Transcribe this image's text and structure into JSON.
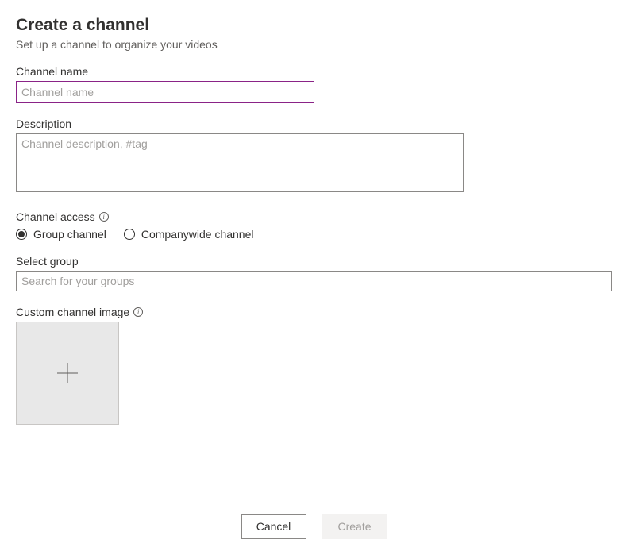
{
  "header": {
    "title": "Create a channel",
    "subtitle": "Set up a channel to organize your videos"
  },
  "channel_name": {
    "label": "Channel name",
    "placeholder": "Channel name",
    "value": ""
  },
  "description": {
    "label": "Description",
    "placeholder": "Channel description, #tag",
    "value": ""
  },
  "channel_access": {
    "label": "Channel access",
    "options": {
      "group": "Group channel",
      "companywide": "Companywide channel"
    },
    "selected": "group"
  },
  "select_group": {
    "label": "Select group",
    "placeholder": "Search for your groups",
    "value": ""
  },
  "custom_image": {
    "label": "Custom channel image"
  },
  "footer": {
    "cancel": "Cancel",
    "create": "Create"
  },
  "info_glyph": "i"
}
